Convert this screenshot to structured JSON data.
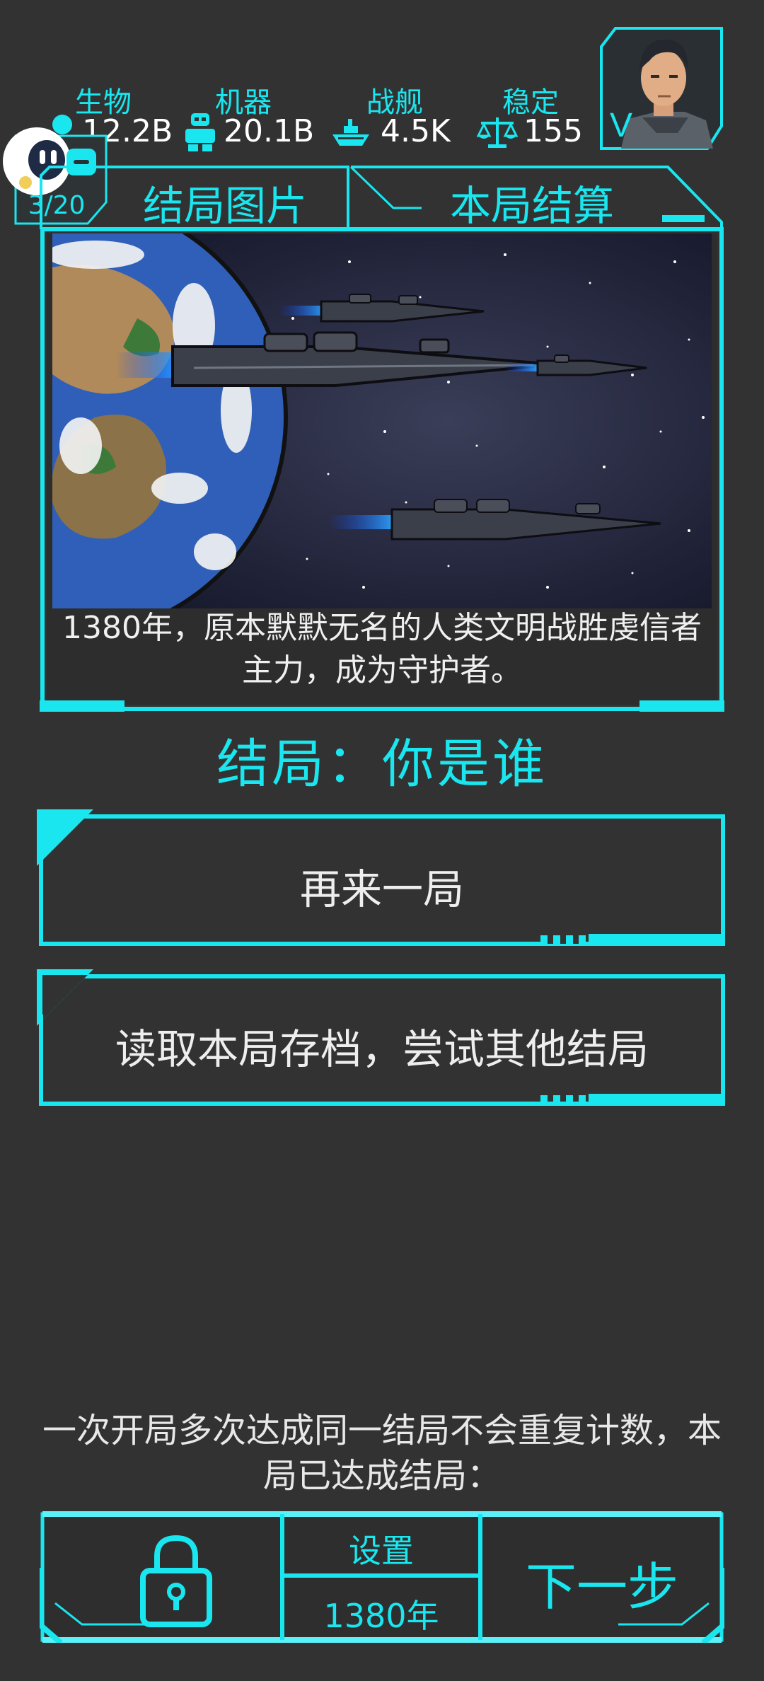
{
  "stats": [
    {
      "label": "生物",
      "value": "12.2B",
      "icon": "dna-icon"
    },
    {
      "label": "机器",
      "value": "20.1B",
      "icon": "robot-icon"
    },
    {
      "label": "战舰",
      "value": "4.5K",
      "icon": "battleship-icon"
    },
    {
      "label": "稳定",
      "value": "155",
      "icon": "scales-icon"
    }
  ],
  "avatar": {
    "badge": "V"
  },
  "assistant": {
    "counter": "3/20"
  },
  "tabs": {
    "ending_image": "结局图片",
    "round_settlement": "本局结算"
  },
  "scene": {
    "caption": "1380年，原本默默无名的人类文明战胜虔信者主力，成为守护者。"
  },
  "ending": {
    "title": "结局：你是谁"
  },
  "buttons": {
    "replay": "再来一局",
    "load_save": "读取本局存档，尝试其他结局"
  },
  "note": {
    "text": "一次开局多次达成同一结局不会重复计数，本局已达成结局："
  },
  "bottom": {
    "settings": "设置",
    "year": "1380年",
    "next": "下一步"
  },
  "colors": {
    "accent": "#19e6ef",
    "background": "#323232"
  }
}
